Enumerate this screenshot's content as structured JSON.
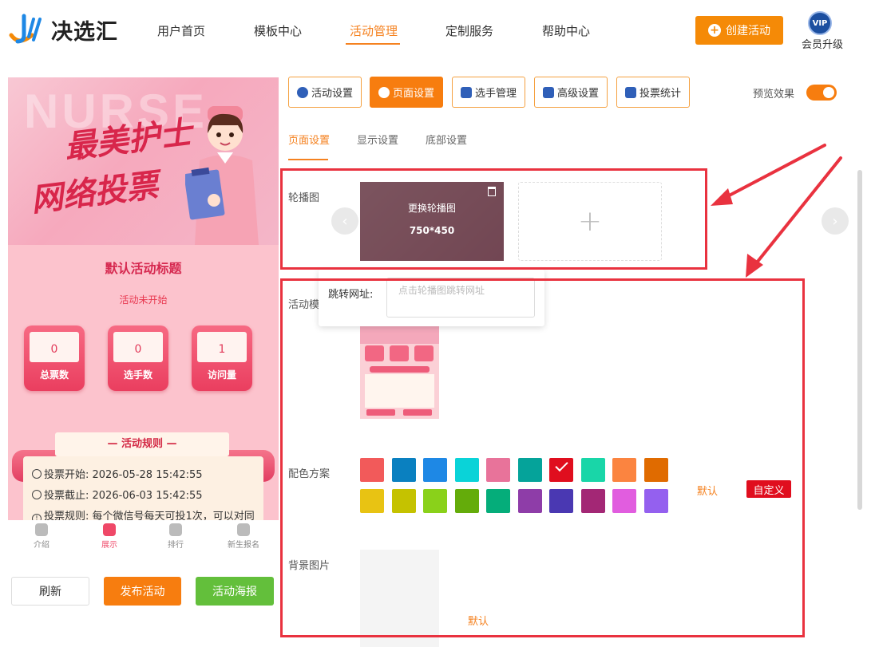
{
  "brand": {
    "name": "决选汇"
  },
  "nav": {
    "items": [
      "用户首页",
      "模板中心",
      "活动管理",
      "定制服务",
      "帮助中心"
    ],
    "create_label": "创建活动",
    "vip_badge": "VIP",
    "vip_label": "会员升级"
  },
  "phone": {
    "banner_bg": "NURSE",
    "banner_line1": "最美护士",
    "banner_line2": "网络投票",
    "title": "默认活动标题",
    "status": "活动未开始",
    "stats": [
      {
        "value": "0",
        "label": "总票数"
      },
      {
        "value": "0",
        "label": "选手数"
      },
      {
        "value": "1",
        "label": "访问量"
      }
    ],
    "rules_title": "— 活动规则 —",
    "rules": [
      "投票开始:  2026-05-28 15:42:55",
      "投票截止:  2026-06-03 15:42:55",
      "投票规则:  每个微信号每天可投1次，可以对同"
    ],
    "tabs": [
      "介绍",
      "展示",
      "排行",
      "新生报名"
    ]
  },
  "actions": {
    "refresh": "刷新",
    "publish": "发布活动",
    "poster": "活动海报"
  },
  "toolbar": {
    "items": [
      "活动设置",
      "页面设置",
      "选手管理",
      "高级设置",
      "投票统计"
    ],
    "preview_label": "预览效果"
  },
  "subtabs": [
    "页面设置",
    "显示设置",
    "底部设置"
  ],
  "form": {
    "carousel_label": "轮播图",
    "carousel_replace": "更换轮播图",
    "carousel_size": "750*450",
    "add_symbol": "+",
    "jump_label": "跳转网址:",
    "jump_placeholder": "点击轮播图跳转网址",
    "template_label": "活动模",
    "color_label": "配色方案",
    "color_default": "默认",
    "color_custom": "自定义",
    "bg_label": "背景图片",
    "bg_default": "默认"
  },
  "colors": {
    "accent": "#f58220",
    "row1": [
      "#f25a5a",
      "#0a80c0",
      "#1e88e5",
      "#0ad3d8",
      "#e8739a",
      "#05a39a",
      "#e00e1e",
      "#19d6a8",
      "#fb8440",
      "#e06b00"
    ],
    "row2": [
      "#e8c313",
      "#c5c200",
      "#8ad11a",
      "#64ac0a",
      "#05ad7a",
      "#8e3da8",
      "#4a38b2",
      "#a32775",
      "#e15ddf",
      "#9460ef"
    ],
    "selected": 6
  }
}
